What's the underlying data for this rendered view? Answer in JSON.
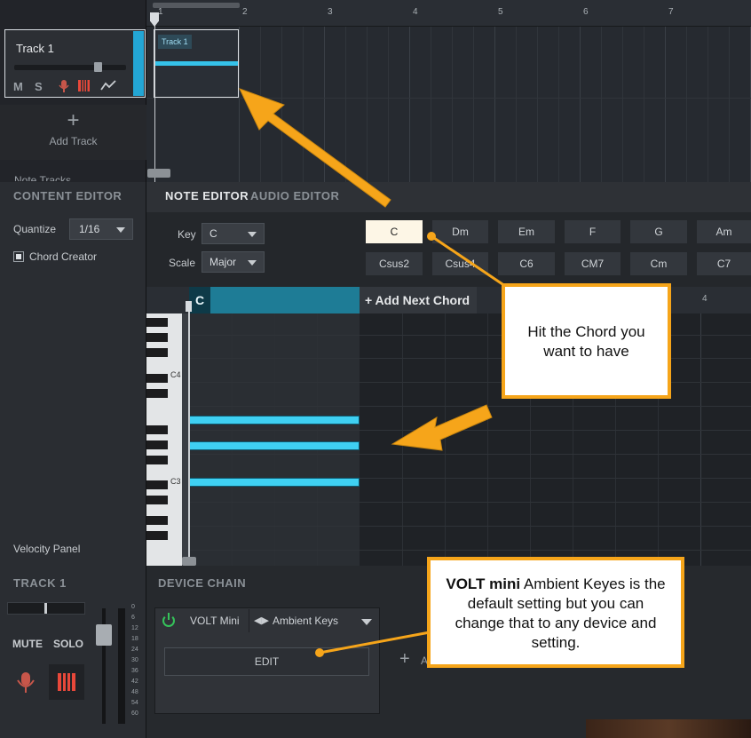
{
  "tracks": {
    "items": [
      {
        "name": "Track 1",
        "buttons": [
          "M",
          "S"
        ]
      }
    ],
    "add_track_label": "Add Track",
    "hidden_track_label": "Note Tracks"
  },
  "arrange": {
    "ruler": [
      "1",
      "2",
      "3",
      "4",
      "5",
      "6",
      "7"
    ],
    "clip_label": "Track 1"
  },
  "content_editor": {
    "title": "CONTENT EDITOR",
    "quantize_label": "Quantize",
    "quantize_value": "1/16",
    "chord_creator_label": "Chord Creator",
    "velocity_label": "Velocity Panel"
  },
  "editor_tabs": {
    "note": "NOTE EDITOR",
    "audio": "AUDIO EDITOR"
  },
  "chord_creator": {
    "key_label": "Key",
    "key_value": "C",
    "scale_label": "Scale",
    "scale_value": "Major",
    "row1": [
      "C",
      "Dm",
      "Em",
      "F",
      "G",
      "Am"
    ],
    "row2": [
      "Csus2",
      "Csus4",
      "C6",
      "CM7",
      "Cm",
      "C7"
    ],
    "active": "C"
  },
  "piano_roll": {
    "chord_label": "C",
    "add_next_label": "+ Add Next Chord",
    "bar_4_label": "4",
    "octave_labels": [
      "C4",
      "C3"
    ]
  },
  "mixer": {
    "title": "TRACK 1",
    "mute_label": "MUTE",
    "solo_label": "SOLO",
    "db_ticks": [
      "0",
      "6",
      "12",
      "18",
      "24",
      "30",
      "36",
      "42",
      "48",
      "54",
      "60"
    ]
  },
  "device_chain": {
    "title": "DEVICE CHAIN",
    "device_name": "VOLT Mini",
    "preset": "Ambient Keys",
    "edit_label": "EDIT",
    "add_label": "A"
  },
  "callouts": {
    "chord_text": "Hit the Chord you want to have",
    "volt_bold": "VOLT mini",
    "volt_rest": " Ambient Keyes is the default setting but you can change that to any device and setting."
  },
  "colors": {
    "accent": "#23a6d5",
    "note": "#3fd0f2",
    "callout_border": "#f6a51a",
    "active_chord": "#fdf6e6"
  }
}
